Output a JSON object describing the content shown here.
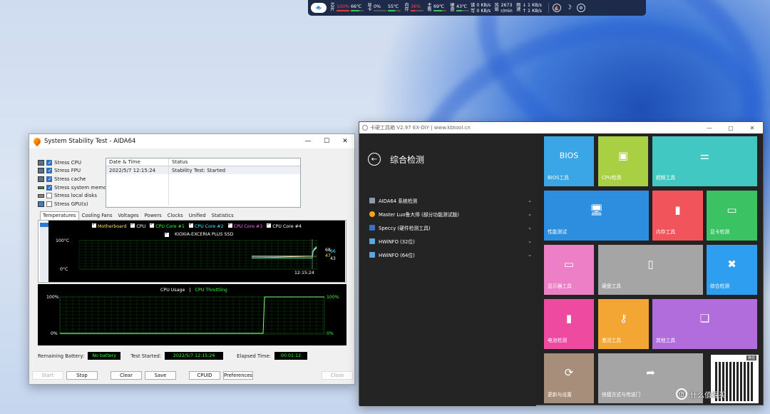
{
  "hwmon": {
    "logo": "🐟",
    "cpu": {
      "label": "芯片",
      "usage": "100%",
      "temp": "66℃",
      "usage_color": "#ff4b4b",
      "fill": 1.0
    },
    "gpu": {
      "label": "显卡",
      "usage": "0%",
      "temp": "55℃",
      "fill": 0.0
    },
    "mem": {
      "label": "内存",
      "usage": "36%",
      "fill": 0.36,
      "usage_color": "#ff4b4b"
    },
    "board": {
      "label": "主板",
      "temp": "69℃",
      "fill": 0.69
    },
    "disk": {
      "label": "硬盘",
      "temp": "43℃",
      "read": "读 0 KB/s",
      "write": "写 0 KB/s",
      "fill": 0.43
    },
    "fan": {
      "label": "风扇",
      "rpm": "2673",
      "unit": "r/min"
    },
    "net": {
      "label": "网速",
      "down": "↓ 1 KB/s",
      "up": "↑ 1 KB/s"
    },
    "icons": [
      "ship-icon",
      "moon-icon",
      "settings-icon"
    ]
  },
  "aida": {
    "title": "System Stability Test - AIDA64",
    "window_buttons": [
      "—",
      "☐",
      "✕"
    ],
    "stress": [
      {
        "label": "Stress CPU",
        "checked": true
      },
      {
        "label": "Stress FPU",
        "checked": true
      },
      {
        "label": "Stress cache",
        "checked": true
      },
      {
        "label": "Stress system memory",
        "checked": true
      },
      {
        "label": "Stress local disks",
        "checked": false
      },
      {
        "label": "Stress GPU(s)",
        "checked": false
      }
    ],
    "log": {
      "col1": "Date & Time",
      "col2": "Status",
      "rows": [
        {
          "time": "2022/5/7 12:15:24",
          "status": "Stability Test: Started"
        }
      ]
    },
    "tabs": [
      "Temperatures",
      "Cooling Fans",
      "Voltages",
      "Powers",
      "Clocks",
      "Unified",
      "Statistics"
    ],
    "temp_graph": {
      "legend": [
        {
          "label": "Motherboard",
          "color": "#ffe066"
        },
        {
          "label": "CPU",
          "color": "#ffffff"
        },
        {
          "label": "CPU Core #1",
          "color": "#39ff39"
        },
        {
          "label": "CPU Core #2",
          "color": "#4fe8ff"
        },
        {
          "label": "CPU Core #3",
          "color": "#ff66ff"
        },
        {
          "label": "CPU Core #4",
          "color": "#ffffff"
        }
      ],
      "legend2": "KIOXIA-EXCERIA PLUS SSD",
      "ymax": "100°C",
      "ymin": "0°C",
      "time": "12:15:24",
      "readouts": [
        "68",
        "66",
        "47",
        "43"
      ]
    },
    "usage_graph": {
      "title_a": "CPU Usage",
      "sep": "|",
      "title_b": "CPU Throttling",
      "left_max": "100%",
      "left_min": "0%",
      "right_max": "100%",
      "right_min": "0%"
    },
    "status": {
      "battery_label": "Remaining Battery:",
      "battery_value": "No battery",
      "started_label": "Test Started:",
      "started_value": "2022/5/7 12:15:24",
      "elapsed_label": "Elapsed Time:",
      "elapsed_value": "00:01:12"
    },
    "buttons": {
      "start": "Start",
      "stop": "Stop",
      "clear": "Clear",
      "save": "Save",
      "cpuid": "CPUID",
      "preferences": "Preferences",
      "close": "Close"
    }
  },
  "kb": {
    "title": "卡硬工具箱 V2.97  EX-DIY   |  www.kbtool.cn",
    "window_buttons": [
      "—",
      "▢",
      "✕"
    ],
    "back_icon": "back-arrow-icon",
    "heading": "综合检测",
    "items": [
      {
        "label": "AIDA64 系统检测",
        "color": "#8a9bb0"
      },
      {
        "label": "Master Luo鲁大师  (部分功能测试版)",
        "color": "#f3a51b"
      },
      {
        "label": "Speccy  (硬件检测工具)",
        "color": "#3c6fbf"
      },
      {
        "label": "HWiNFO  (32位)",
        "color": "#5aa6e0"
      },
      {
        "label": "HWiNFO  (64位)",
        "color": "#5aa6e0"
      }
    ],
    "tiles": [
      {
        "label": "BIOS工具",
        "icon": "BIOS",
        "color": "#3aa6e6"
      },
      {
        "label": "CPU检测",
        "icon": "▣",
        "color": "#a9d042"
      },
      {
        "label": "超频工具",
        "icon": "⚌",
        "color": "#42c8c2"
      },
      {
        "label": "性能测试",
        "icon": "🖥",
        "color": "#2d8ee0"
      },
      {
        "label": "内存工具",
        "icon": "▮",
        "color": "#f2545b"
      },
      {
        "label": "显卡检测",
        "icon": "▭",
        "color": "#3bc263"
      },
      {
        "label": "显示器工具",
        "icon": "▭",
        "color": "#ec7fc6"
      },
      {
        "label": "硬盘工具",
        "icon": "▯",
        "color": "#a5a5a5"
      },
      {
        "label": "综合检测",
        "icon": "✖",
        "color": "#2e9ef0"
      },
      {
        "label": "电池检测",
        "icon": "▮",
        "color": "#ee4aa0"
      },
      {
        "label": "激活工具",
        "icon": "⚷",
        "color": "#f4a634"
      },
      {
        "label": "其他工具",
        "icon": "❏",
        "color": "#b26ddc"
      },
      {
        "label": "更新与设置",
        "icon": "⟳",
        "color": "#a68e7a"
      },
      {
        "label": "快捷方式与传送门",
        "icon": "➦",
        "color": "#a5a5a5"
      }
    ],
    "qr_tag": "微信"
  },
  "watermark": {
    "icon": "值",
    "text": "什么值得买"
  }
}
